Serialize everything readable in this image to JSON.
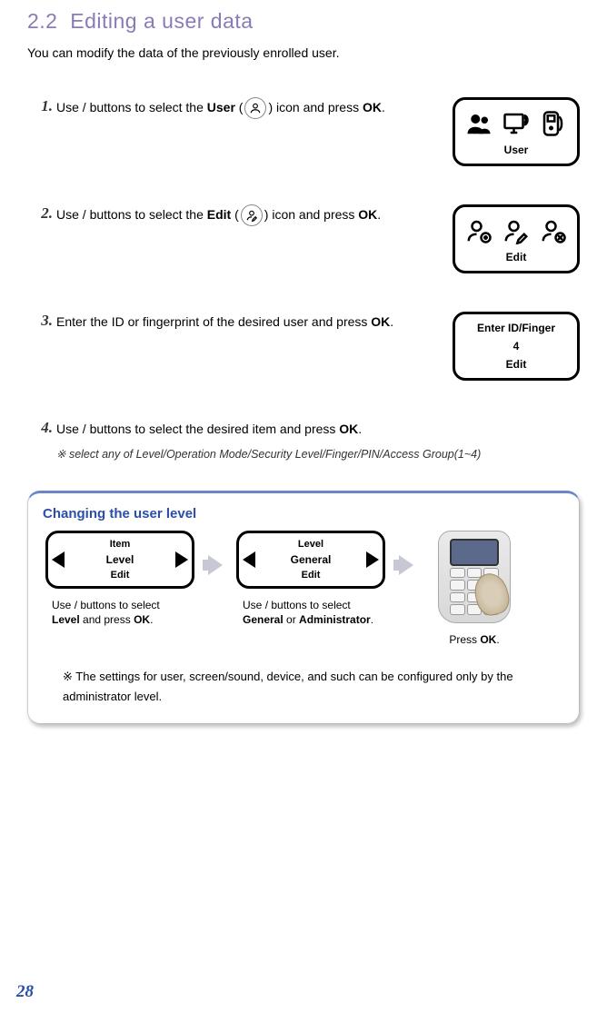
{
  "section": {
    "number": "2.2",
    "title": "Editing a user data"
  },
  "intro": "You can modify the data of the previously enrolled user.",
  "steps": [
    {
      "num": "1.",
      "pre": "Use ",
      "mid1": " / ",
      "mid2": " buttons to select the ",
      "bold1": "User",
      "paren_open": " (",
      "paren_close": ") icon and press ",
      "bold2": "OK",
      "end": ".",
      "lcd_label": "User"
    },
    {
      "num": "2.",
      "pre": "Use ",
      "mid1": " / ",
      "mid2": " buttons to select the ",
      "bold1": "Edit",
      "paren_open": " (",
      "paren_close": ") icon and press ",
      "bold2": "OK",
      "end": ".",
      "lcd_label": "Edit"
    },
    {
      "num": "3.",
      "text_a": "Enter the ID or fingerprint of the desired user and press ",
      "bold1": "OK",
      "end": ".",
      "lcd_title": "Enter ID/Finger",
      "lcd_mid": "4",
      "lcd_bot": "Edit"
    },
    {
      "num": "4.",
      "pre": "Use ",
      "mid1": " / ",
      "mid2": " buttons to select the desired item and press ",
      "bold1": "OK",
      "end": ".",
      "note": "※ select any of Level/Operation Mode/Security Level/Finger/PIN/Access Group(1~4)"
    }
  ],
  "tip": {
    "title": "Changing the user level",
    "col1": {
      "lcd_t": "Item",
      "lcd_m": "Level",
      "lcd_b": "Edit",
      "cap_a": "Use ",
      "cap_b": " / ",
      "cap_c": " buttons to select ",
      "cap_bold1": "Level",
      "cap_d": " and press ",
      "cap_bold2": "OK",
      "cap_e": "."
    },
    "col2": {
      "lcd_t": "Level",
      "lcd_m": "General",
      "lcd_b": "Edit",
      "cap_a": "Use ",
      "cap_b": " / ",
      "cap_c": " buttons to select ",
      "cap_bold1": "General",
      "cap_d": " or ",
      "cap_bold2": "Administrator",
      "cap_e": "."
    },
    "col3": {
      "cap_a": "Press ",
      "cap_bold": "OK",
      "cap_b": "."
    },
    "note": "※ The settings for user, screen/sound, device, and such can be configured only by the administrator level."
  },
  "page_number": "28"
}
